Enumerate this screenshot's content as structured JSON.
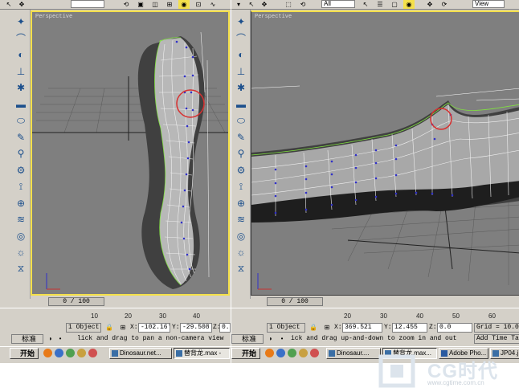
{
  "left_window": {
    "viewport_label": "Perspective",
    "time_slider": "0 / 100",
    "ruler_ticks": [
      "10",
      "20",
      "30",
      "40"
    ],
    "status": {
      "selection": "1 Object",
      "x_label": "X:",
      "x_value": "-102.16'",
      "y_label": "Y:",
      "y_value": "-29.508",
      "z_label": "Z:",
      "z_value": "0."
    },
    "ime_label": "标准",
    "prompt": "lick and drag to pan a non-camera view"
  },
  "right_window": {
    "viewport_label": "Perspective",
    "toolbar_select": "All",
    "toolbar_view": "View",
    "time_slider": "0 / 100",
    "ruler_ticks": [
      "20",
      "30",
      "40",
      "50",
      "60"
    ],
    "status": {
      "selection": "1 Object",
      "x_label": "X:",
      "x_value": "369.521",
      "y_label": "Y:",
      "y_value": "12.455",
      "z_label": "Z:",
      "z_value": "0.0",
      "grid": "Grid = 10.0"
    },
    "ime_label": "标准",
    "prompt": "ick and drag up-and-down to zoom in and out",
    "add_time_tag": "Add Time Tag"
  },
  "taskbar_left": {
    "start_label": "开始",
    "tasks": [
      {
        "label": "Dinosaur.net...",
        "active": false
      },
      {
        "label": "替背龙.max -",
        "active": true
      }
    ]
  },
  "taskbar_right": {
    "start_label": "开始",
    "tasks": [
      {
        "label": "Dinosaur....",
        "active": false
      },
      {
        "label": "替背龙.max...",
        "active": true
      },
      {
        "label": "Adobe Pho...",
        "active": false
      },
      {
        "label": "JP04.j",
        "active": false
      }
    ]
  },
  "watermark": {
    "brand": "CG时代",
    "url": "www.cgtime.com.cn"
  },
  "colors": {
    "viewport_bg": "#7f7f7f",
    "active_border": "#f4e04a",
    "ui_gray": "#d4d0c8",
    "highlight_circle": "#d83030",
    "mesh_white": "#f0f0f0",
    "mesh_green": "#80e040",
    "vertex_blue": "#3030c8"
  },
  "icons": {
    "sidebar": [
      "create-icon",
      "modify-icon",
      "hierarchy-icon",
      "motion-icon",
      "display-icon",
      "box-icon",
      "cylinder-icon",
      "brush-icon",
      "magnet-icon",
      "gear-icon",
      "bone-icon",
      "plug-icon",
      "wave-icon",
      "camera-icon",
      "light-icon",
      "ribbon-icon"
    ]
  }
}
